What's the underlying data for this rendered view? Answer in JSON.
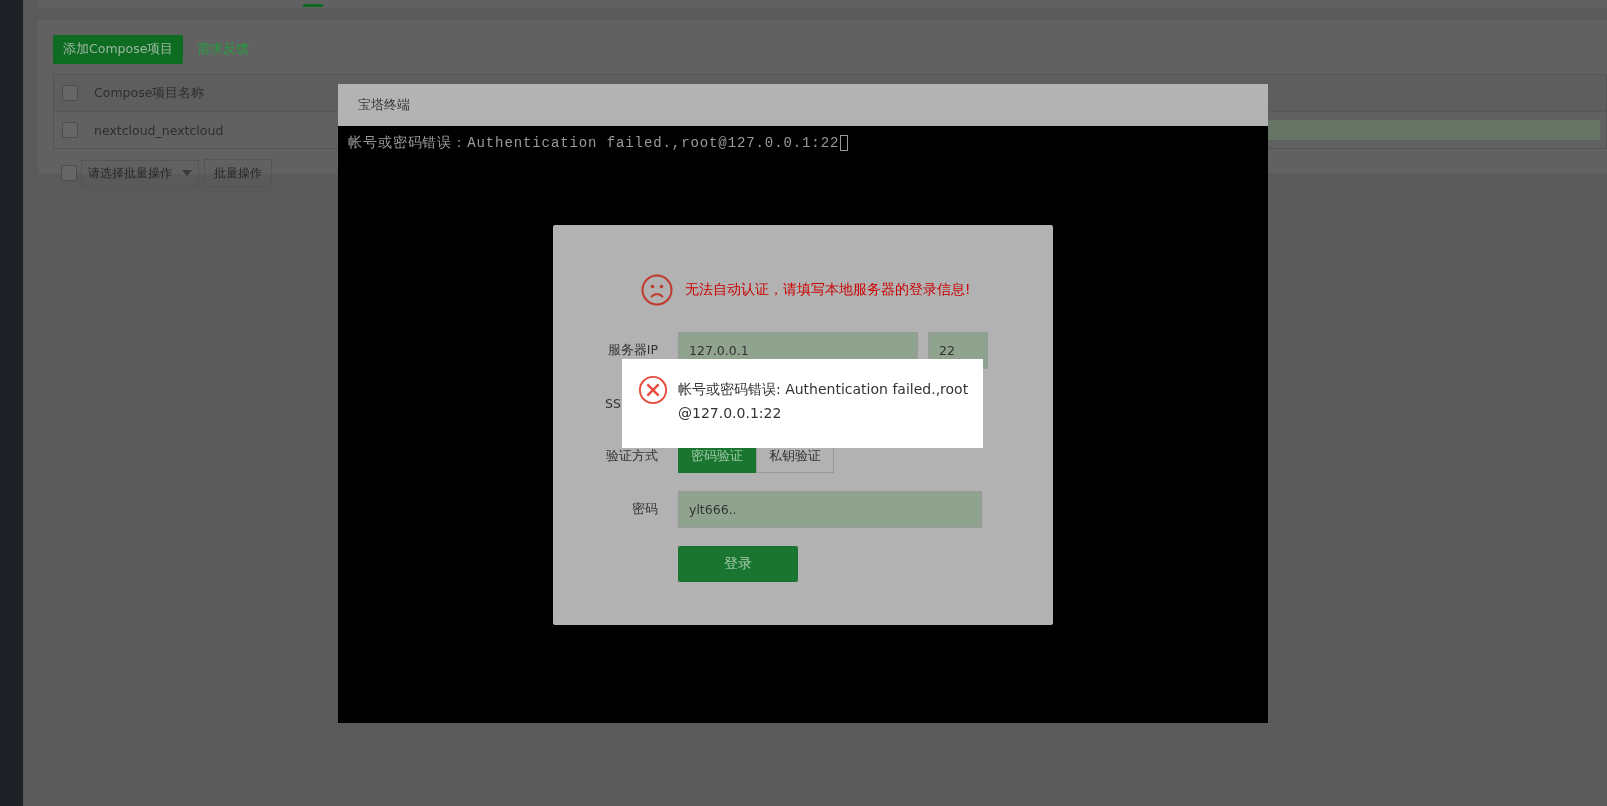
{
  "toolbar": {
    "add_button": "添加Compose项目",
    "feedback_link": "需求反馈"
  },
  "table": {
    "header_checked": false,
    "columns": [
      "Compose项目名称"
    ],
    "rows": [
      {
        "name": "nextcloud_nextcloud",
        "checked": false
      }
    ]
  },
  "batch": {
    "checked": false,
    "select_placeholder": "请选择批量操作",
    "apply_button": "批量操作"
  },
  "terminal": {
    "title": "宝塔终端",
    "lines": [
      "帐号或密码错误：Authentication failed.,root@127.0.0.1:22"
    ]
  },
  "login": {
    "message": "无法自动认证，请填写本地服务器的登录信息!",
    "fields": [
      {
        "kind": "host",
        "label": "服务器IP",
        "value": "127.0.0.1",
        "port": "22"
      },
      {
        "kind": "label",
        "label": "SS"
      },
      {
        "kind": "choice",
        "label": "验证方式",
        "options": [
          {
            "label": "密码验证",
            "selected": true
          },
          {
            "label": "私钥验证",
            "selected": false
          }
        ]
      },
      {
        "kind": "text",
        "label": "密码",
        "value": "ylt666.."
      }
    ],
    "submit": "登录"
  },
  "toast": {
    "message": "帐号或密码错误: Authentication failed.,root@127.0.0.1:22"
  }
}
